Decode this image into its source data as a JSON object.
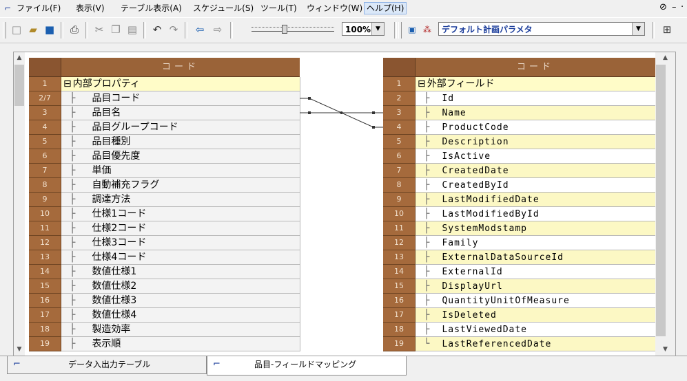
{
  "menubar": {
    "items": [
      "ファイル(F)",
      "表示(V)",
      "テーブル表示(A)",
      "スケジュール(S)",
      "ツール(T)",
      "ウィンドウ(W)",
      "ヘルプ(H)"
    ],
    "active_index": 6
  },
  "toolbar": {
    "zoom_value": "100%",
    "zoom_level_percent": 100,
    "icons": [
      "new-document-icon",
      "open-folder-icon",
      "save-icon",
      "print-icon",
      "cut-icon",
      "copy-icon",
      "paste-icon",
      "undo-icon",
      "redo-icon",
      "back-arrow-icon",
      "forward-arrow-icon",
      "run-schedule-icon",
      "parameter-icon",
      "layout-icon"
    ],
    "param_select": "デフォルト計画パラメタ"
  },
  "left_table": {
    "header": "コード",
    "rows": [
      {
        "num": "1",
        "label": "内部プロパティ",
        "root": true
      },
      {
        "num": "2/7",
        "label": "品目コード"
      },
      {
        "num": "3",
        "label": "品目名"
      },
      {
        "num": "4",
        "label": "品目グループコード"
      },
      {
        "num": "5",
        "label": "品目種別"
      },
      {
        "num": "6",
        "label": "品目優先度"
      },
      {
        "num": "7",
        "label": "単価"
      },
      {
        "num": "8",
        "label": "自動補充フラグ"
      },
      {
        "num": "9",
        "label": "調達方法"
      },
      {
        "num": "10",
        "label": "仕様1コード"
      },
      {
        "num": "11",
        "label": "仕様2コード"
      },
      {
        "num": "12",
        "label": "仕様3コード"
      },
      {
        "num": "13",
        "label": "仕様4コード"
      },
      {
        "num": "14",
        "label": "数値仕様1"
      },
      {
        "num": "15",
        "label": "数値仕様2"
      },
      {
        "num": "16",
        "label": "数値仕様3"
      },
      {
        "num": "17",
        "label": "数値仕様4"
      },
      {
        "num": "18",
        "label": "製造効率"
      },
      {
        "num": "19",
        "label": "表示順"
      }
    ]
  },
  "right_table": {
    "header": "コード",
    "rows": [
      {
        "num": "1",
        "label": "外部フィールド",
        "root": true
      },
      {
        "num": "2",
        "label": "Id"
      },
      {
        "num": "3",
        "label": "Name"
      },
      {
        "num": "4",
        "label": "ProductCode"
      },
      {
        "num": "5",
        "label": "Description"
      },
      {
        "num": "6",
        "label": "IsActive"
      },
      {
        "num": "7",
        "label": "CreatedDate"
      },
      {
        "num": "8",
        "label": "CreatedById"
      },
      {
        "num": "9",
        "label": "LastModifiedDate"
      },
      {
        "num": "10",
        "label": "LastModifiedById"
      },
      {
        "num": "11",
        "label": "SystemModstamp"
      },
      {
        "num": "12",
        "label": "Family"
      },
      {
        "num": "13",
        "label": "ExternalDataSourceId"
      },
      {
        "num": "14",
        "label": "ExternalId"
      },
      {
        "num": "15",
        "label": "DisplayUrl"
      },
      {
        "num": "16",
        "label": "QuantityUnitOfMeasure"
      },
      {
        "num": "17",
        "label": "IsDeleted"
      },
      {
        "num": "18",
        "label": "LastViewedDate"
      },
      {
        "num": "19",
        "label": "LastReferencedDate"
      }
    ]
  },
  "mappings": [
    {
      "from_row": 2,
      "to_row": 4
    },
    {
      "from_row": 3,
      "to_row": 3
    }
  ],
  "tabs": [
    {
      "label": "データ入出力テーブル",
      "active": false
    },
    {
      "label": "品目-フィールドマッピング",
      "active": true
    }
  ],
  "colors": {
    "header_brown": "#9a6338",
    "row_number_brown": "#a56a3c",
    "highlight_yellow": "#fcf8c4",
    "selected_yellow": "#fffcc8"
  }
}
